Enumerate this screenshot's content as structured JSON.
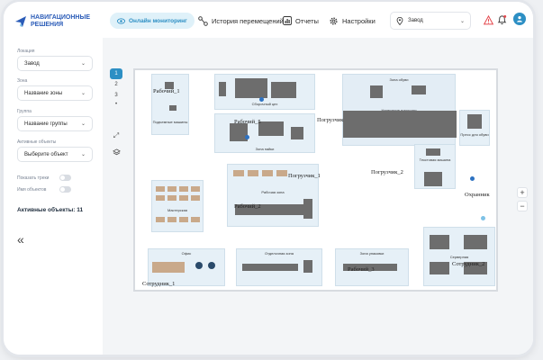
{
  "brand": {
    "line1": "НАВИГАЦИОННЫЕ",
    "line2": "РЕШЕНИЯ"
  },
  "nav": {
    "monitoring": "Онлайн мониторинг",
    "history": "История перемещений",
    "reports": "Отчеты",
    "settings": "Настройки",
    "site": "Завод"
  },
  "filters": {
    "location_label": "Локация",
    "location_value": "Завод",
    "zone_label": "Зона",
    "zone_value": "Название зоны",
    "group_label": "Группа",
    "group_value": "Название группы",
    "object_label": "Активные объекты",
    "object_value": "Выберите объект",
    "toggle_trail": "Показать треки",
    "toggle_names": "Имя объектов",
    "active_objects": "Активные объекты: 11"
  },
  "floors": [
    "1",
    "2",
    "3"
  ],
  "floor_more": "•",
  "zones": {
    "assembly": "Сборочный цех",
    "lifting": "Подъемные машины",
    "soldering": "Зона пайки",
    "shoes": "Зона обуви",
    "coatings": "Нанесение покрытия",
    "press": "Пресс для обуви",
    "textile": "Текстовая машина",
    "workzone": "Рабочая зона",
    "workshop": "Мастерская",
    "office": "Офис",
    "finishing": "Отделочная зона",
    "packing": "Зона упаковки",
    "server": "Серверная"
  },
  "people": {
    "r1": "Рабочий_1",
    "r2": "Рабочий_2",
    "r5": "Рабочий_5",
    "l1": "Погрузчик_1",
    "l2": "Погрузчик_2",
    "lw": "Погрузчик",
    "guard": "Охранник",
    "emp1": "Сотрудник_1",
    "emp2": "Сотрудник_2",
    "r3": "Рабочий_3"
  },
  "colors": {
    "accent": "#2d8fc4",
    "brand": "#2b5cb8",
    "alert": "#e5484d"
  }
}
